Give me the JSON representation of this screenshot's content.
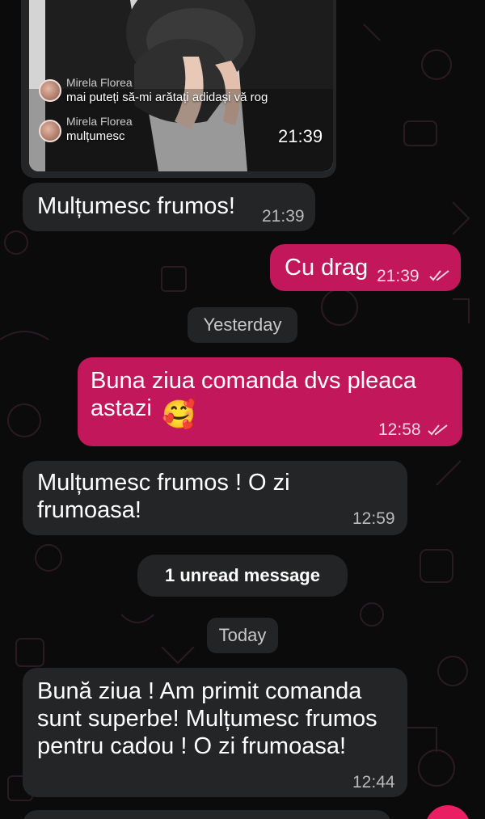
{
  "video_preview": {
    "comments": [
      {
        "name": "Mirela Florea",
        "text": "mai puteți să-mi arătați adidași vă rog"
      },
      {
        "name": "Mirela Florea",
        "text": "mulțumesc"
      }
    ],
    "time": "21:39"
  },
  "messages": [
    {
      "direction": "incoming",
      "text": "Mulțumesc frumos!",
      "time": "21:39"
    },
    {
      "direction": "outgoing",
      "text": "Cu drag",
      "time": "21:39",
      "status": "read"
    },
    {
      "direction": "outgoing",
      "text": "Buna ziua comanda dvs pleaca\nastazi",
      "emoji": "🥰",
      "time": "12:58",
      "status": "read"
    },
    {
      "direction": "incoming",
      "text": "Mulțumesc  frumos  ! O zi\nfrumoasa!",
      "time": "12:59"
    },
    {
      "direction": "incoming",
      "text": "Bună ziua ! Am primit comanda\nsunt superbe! Mulțumesc  frumos\npentru cadou ! O zi frumoasa!",
      "time": "12:44"
    }
  ],
  "separators": {
    "yesterday": "Yesterday",
    "unread": "1 unread message",
    "today": "Today"
  },
  "colors": {
    "background": "#0b0b0c",
    "incoming_bubble": "#242526",
    "outgoing_bubble": "#c2185b",
    "fab": "#e91e63"
  }
}
